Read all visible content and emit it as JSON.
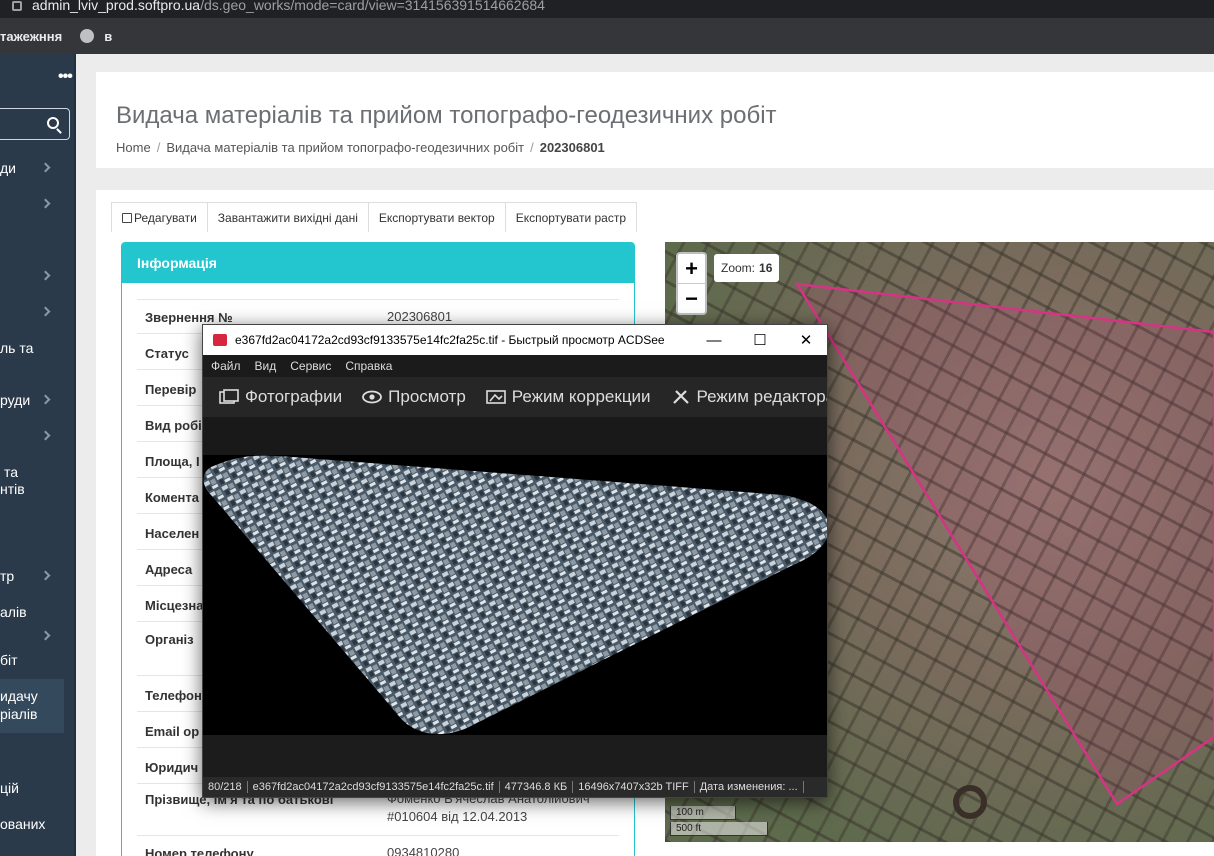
{
  "browser": {
    "url_host": "admin_lviv_prod.softpro.ua",
    "url_path": "/ds.geo_works/mode=card/view=314156391514662684",
    "bookmark_1": "тажежння",
    "bookmark_2": "в"
  },
  "sidebar": {
    "items": [
      "ди",
      "ль та",
      "руди",
      "та",
      "нтів",
      "тр",
      "алів",
      "біт",
      "идачу",
      "ріалів",
      "цій",
      "ованих"
    ]
  },
  "header": {
    "title": "Видача матеріалів та прийом топографо-геодезичних робіт",
    "breadcrumb": [
      "Home",
      "Видача матеріалів та прийом топографо-геодезичних робіт",
      "202306801"
    ]
  },
  "tabs": [
    "Редагувати",
    "Завантажити вихідні дані",
    "Експортувати вектор",
    "Експортувати растр"
  ],
  "info": {
    "title": "Інформація",
    "rows": [
      {
        "label": "Звернення №",
        "value": "202306801"
      },
      {
        "label": "Статус",
        "value": ""
      },
      {
        "label": "Перевір",
        "value": ""
      },
      {
        "label": "Вид робі",
        "value": ""
      },
      {
        "label": "Площа, І",
        "value": ""
      },
      {
        "label": "Комента",
        "value": ""
      },
      {
        "label": "Населен",
        "value": ""
      },
      {
        "label": "Адреса",
        "value": ""
      },
      {
        "label": "Місцезна",
        "value": ""
      },
      {
        "label": "Організ",
        "value": ""
      },
      {
        "label": "Телефон",
        "value": ""
      },
      {
        "label": "Email ор",
        "value": ""
      },
      {
        "label": "Юридич",
        "value": ""
      },
      {
        "label": "Прізвище, ім'я та по батькові",
        "value": "Фоменко В'ячеслав Анатолійович",
        "value2": "#010604 від 12.04.2013"
      },
      {
        "label": "Номер телефону",
        "value": "0934810280"
      }
    ]
  },
  "map": {
    "zoom_label": "Zoom:",
    "zoom_value": "16",
    "zoom_in": "+",
    "zoom_out": "−",
    "scale_m": "100 m",
    "scale_ft": "500 ft",
    "polygon_color": "#d63384"
  },
  "acdsee": {
    "title": "e367fd2ac04172a2cd93cf9133575e14fc2fa25c.tif - Быстрый просмотр ACDSee",
    "menu": [
      "Файл",
      "Вид",
      "Сервис",
      "Справка"
    ],
    "tools": [
      "Фотографии",
      "Просмотр",
      "Режим коррекции",
      "Режим редактора"
    ],
    "status": [
      "80/218",
      "e367fd2ac04172a2cd93cf9133575e14fc2fa25c.tif",
      "477346.8 КБ",
      "16496x7407x32b TIFF",
      "Дата изменения: ..."
    ],
    "minimize": "—",
    "maximize": "☐",
    "close": "✕"
  }
}
